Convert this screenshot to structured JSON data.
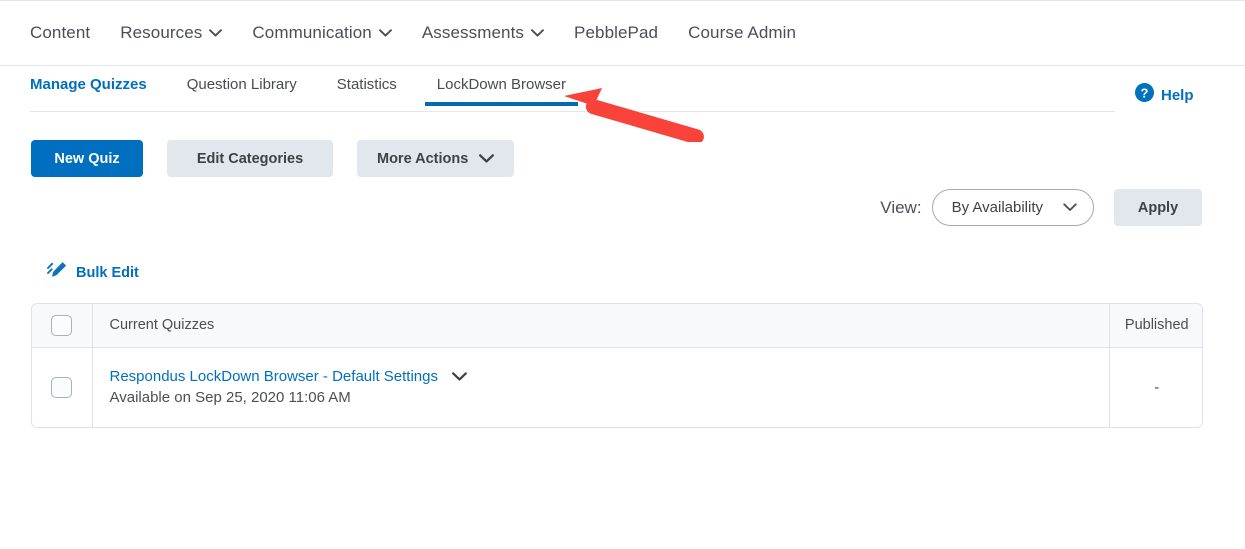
{
  "top_nav": {
    "items": [
      {
        "label": "Content",
        "has_caret": false,
        "icon": null
      },
      {
        "label": "Resources",
        "has_caret": true,
        "icon": "chevron-down-icon"
      },
      {
        "label": "Communication",
        "has_caret": true,
        "icon": "chevron-down-icon"
      },
      {
        "label": "Assessments",
        "has_caret": true,
        "icon": "chevron-down-icon"
      },
      {
        "label": "PebblePad",
        "has_caret": false,
        "icon": null
      },
      {
        "label": "Course Admin",
        "has_caret": false,
        "icon": null
      }
    ]
  },
  "tabs": {
    "items": [
      {
        "label": "Manage Quizzes",
        "current": true,
        "underlined": false
      },
      {
        "label": "Question Library",
        "current": false,
        "underlined": false
      },
      {
        "label": "Statistics",
        "current": false,
        "underlined": false
      },
      {
        "label": "LockDown Browser",
        "current": false,
        "underlined": true
      }
    ]
  },
  "help": {
    "label": "Help",
    "icon": "help-circle-icon"
  },
  "toolbar": {
    "new_quiz_label": "New Quiz",
    "edit_categories_label": "Edit Categories",
    "more_actions_label": "More Actions",
    "more_actions_icon": "chevron-down-icon"
  },
  "view_controls": {
    "label": "View:",
    "selected": "By Availability",
    "options": [
      "By Availability"
    ],
    "caret_icon": "chevron-down-icon",
    "apply_label": "Apply"
  },
  "bulk_edit": {
    "label": "Bulk Edit",
    "icon": "pencil-edit-icon"
  },
  "table": {
    "headers": {
      "select_all": "",
      "name": "Current Quizzes",
      "published": "Published"
    },
    "rows": [
      {
        "checked": false,
        "title": "Respondus LockDown Browser - Default Settings",
        "title_caret_icon": "chevron-down-icon",
        "subtitle": "Available on Sep 25, 2020 11:06 AM",
        "published": "-"
      }
    ]
  },
  "annotation": {
    "type": "arrow",
    "color": "#f9423a",
    "points_to": "LockDown Browser"
  },
  "colors": {
    "primary_blue": "#006fbf",
    "tab_underline": "#036caf",
    "link_blue": "#006fbf",
    "secondary_button": "#e2e7ed",
    "table_header_bg": "#f7f9fb",
    "border": "#dfe3e8",
    "annotation_red": "#f9423a"
  }
}
